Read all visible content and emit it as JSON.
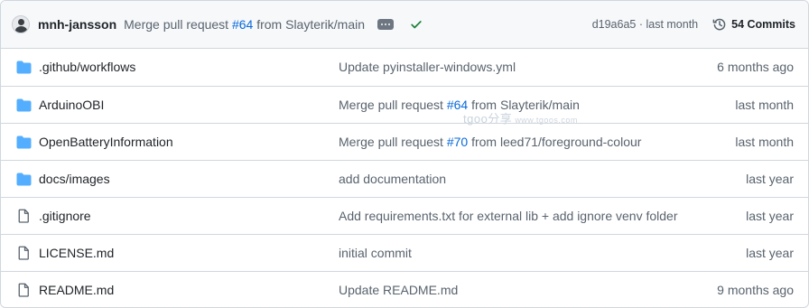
{
  "commit": {
    "author": "mnh-jansson",
    "message_prefix": "Merge pull request ",
    "message_link": "#64",
    "message_suffix": " from Slayterik/main",
    "sha": "d19a6a5",
    "separator": " · ",
    "time": "last month",
    "commits_label": "54 Commits",
    "status": "success"
  },
  "watermark": {
    "text": "tgoo分享",
    "url": "www.tgoos.com"
  },
  "files": [
    {
      "type": "folder",
      "name": ".github/workflows",
      "msg_prefix": "Update pyinstaller-windows.yml",
      "msg_link": "",
      "msg_suffix": "",
      "age": "6 months ago"
    },
    {
      "type": "folder",
      "name": "ArduinoOBI",
      "msg_prefix": "Merge pull request ",
      "msg_link": "#64",
      "msg_suffix": " from Slayterik/main",
      "age": "last month"
    },
    {
      "type": "folder",
      "name": "OpenBatteryInformation",
      "msg_prefix": "Merge pull request ",
      "msg_link": "#70",
      "msg_suffix": " from leed71/foreground-colour",
      "age": "last month"
    },
    {
      "type": "folder",
      "name": "docs/images",
      "msg_prefix": "add documentation",
      "msg_link": "",
      "msg_suffix": "",
      "age": "last year"
    },
    {
      "type": "file",
      "name": ".gitignore",
      "msg_prefix": "Add requirements.txt for external lib + add ignore venv folder",
      "msg_link": "",
      "msg_suffix": "",
      "age": "last year"
    },
    {
      "type": "file",
      "name": "LICENSE.md",
      "msg_prefix": "initial commit",
      "msg_link": "",
      "msg_suffix": "",
      "age": "last year"
    },
    {
      "type": "file",
      "name": "README.md",
      "msg_prefix": "Update README.md",
      "msg_link": "",
      "msg_suffix": "",
      "age": "9 months ago"
    }
  ],
  "colors": {
    "folder": "#54aeff",
    "link": "#0969da",
    "success": "#1a7f37",
    "muted": "#59636e",
    "border": "#d0d7de"
  }
}
